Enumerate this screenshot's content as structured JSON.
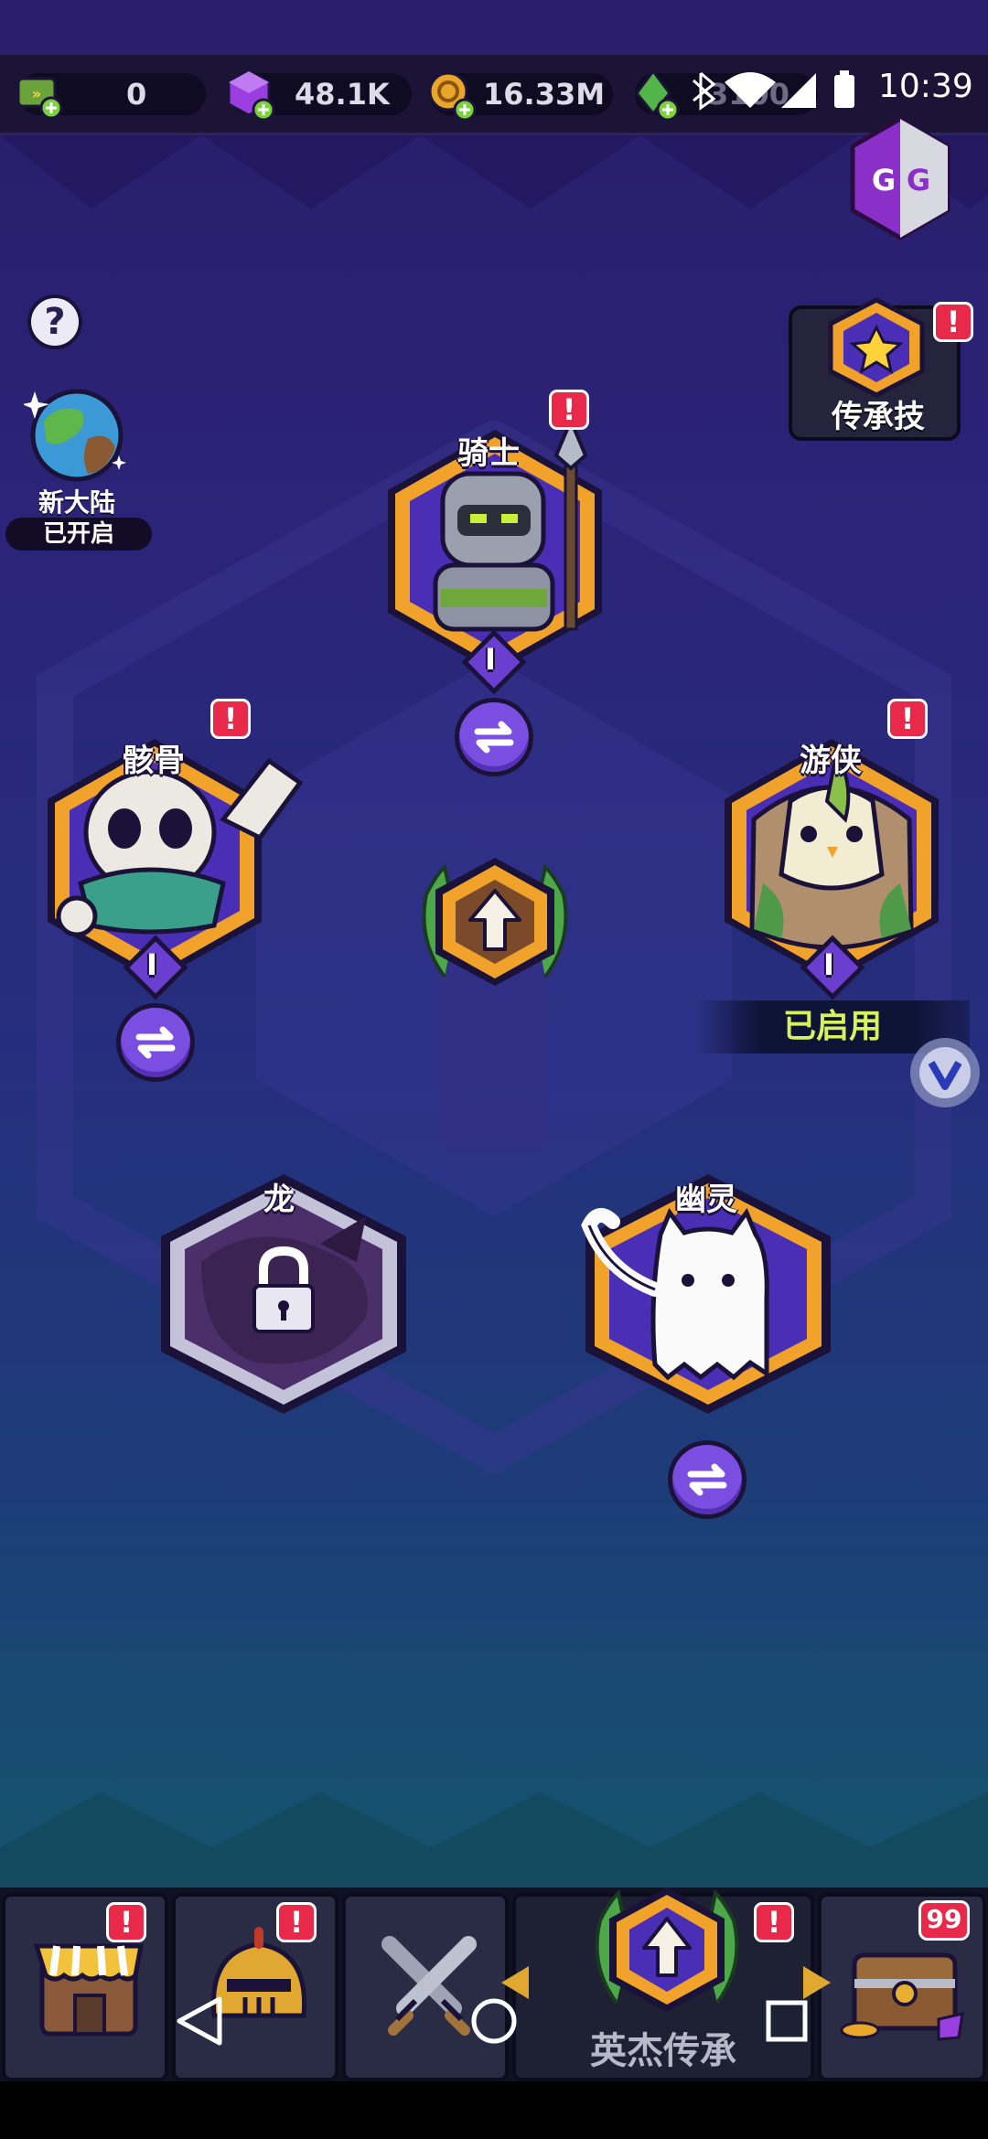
{
  "status_bar": {
    "time": "10:39"
  },
  "currencies": [
    {
      "icon": "energy-ticket-icon",
      "value": "0"
    },
    {
      "icon": "purple-gem-icon",
      "value": "48.1K"
    },
    {
      "icon": "gold-coin-icon",
      "value": "16.33M"
    },
    {
      "icon": "green-crystal-icon",
      "value": "3100"
    }
  ],
  "widgets": {
    "help": "?",
    "new_continent": {
      "label": "新大陆",
      "status": "已开启"
    },
    "legacy_skill": {
      "label": "传承技",
      "alert": "!"
    }
  },
  "center_button": {
    "icon": "upgrade-arrow-icon"
  },
  "heroes": {
    "knight": {
      "name": "骑士",
      "level": "I",
      "alert": "!"
    },
    "skeleton": {
      "name": "骸骨",
      "level": "I",
      "alert": "!"
    },
    "ranger": {
      "name": "游侠",
      "level": "I",
      "alert": "!",
      "status": "已启用"
    },
    "dragon": {
      "name": "龙",
      "locked": true
    },
    "ghost": {
      "name": "幽灵"
    }
  },
  "bottom_nav": {
    "tabs": [
      {
        "name": "shop",
        "icon": "shop-icon",
        "alert": "!"
      },
      {
        "name": "equipment",
        "icon": "helmet-icon",
        "alert": "!"
      },
      {
        "name": "battle",
        "icon": "crossed-swords-icon"
      },
      {
        "name": "legacy",
        "icon": "upgrade-arrow-icon",
        "alert": "!",
        "label": "英杰传承"
      },
      {
        "name": "chest",
        "icon": "treasure-chest-icon",
        "badge": "99"
      }
    ]
  },
  "colors": {
    "alert_red": "#e8294a",
    "hex_gold": "#f0a22a",
    "hex_purple": "#4a2fb6",
    "active_green": "#d7f25a",
    "swap_purple": "#7a4ee0"
  }
}
